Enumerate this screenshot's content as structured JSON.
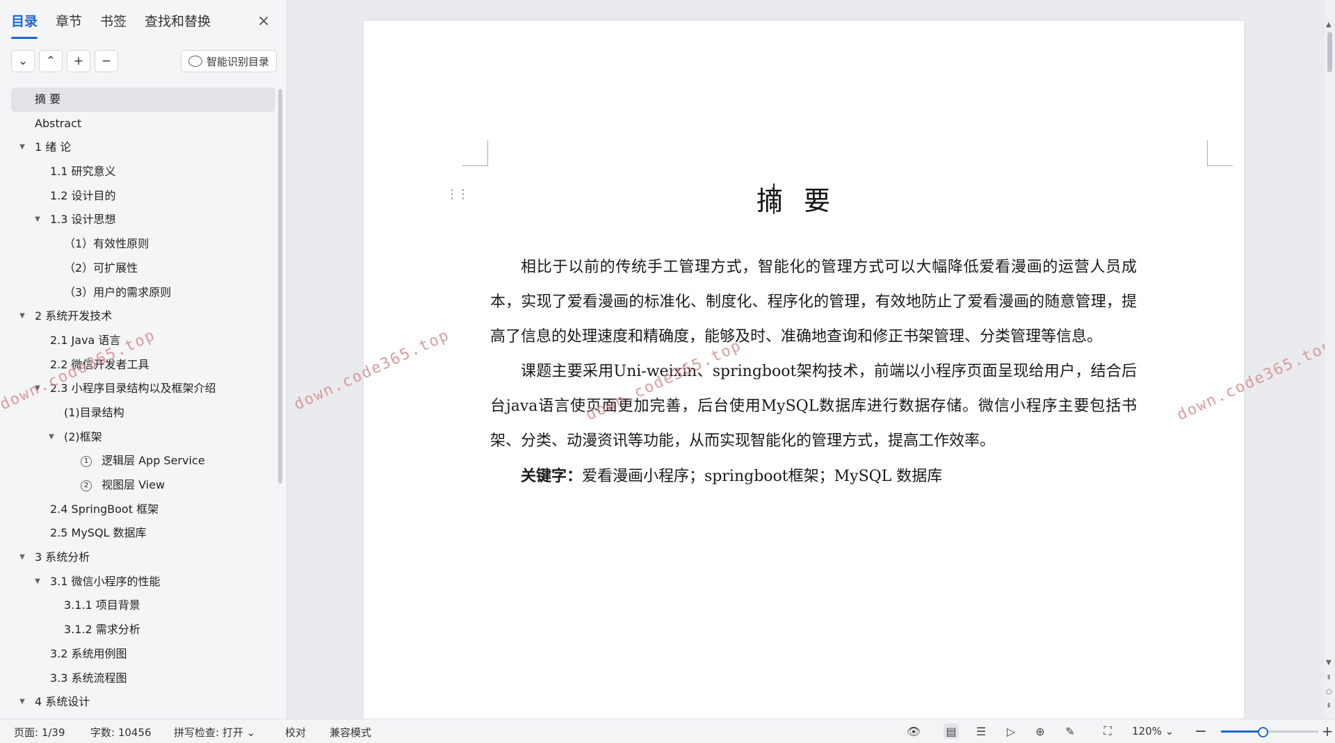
{
  "sidebar": {
    "tabs": [
      "目录",
      "章节",
      "书签",
      "查找和替换"
    ],
    "active_tab": "目录",
    "close_icon": "×",
    "tools": [
      "⌄",
      "⌃",
      "+",
      "−"
    ],
    "ai_button_label": "智能识别目录",
    "toc": [
      {
        "label": "摘  要",
        "level": 1,
        "selected": true,
        "toggle": false
      },
      {
        "label": "Abstract",
        "level": 1,
        "toggle": false
      },
      {
        "label": "1  绪  论",
        "level": 1,
        "toggle": true
      },
      {
        "label": "1.1 研究意义",
        "level": 2,
        "toggle": false
      },
      {
        "label": "1.2 设计目的",
        "level": 2,
        "toggle": false
      },
      {
        "label": "1.3 设计思想",
        "level": 2,
        "toggle": true
      },
      {
        "label": "（1）有效性原则",
        "level": 3,
        "toggle": false
      },
      {
        "label": "（2）可扩展性",
        "level": 3,
        "toggle": false
      },
      {
        "label": "（3）用户的需求原则",
        "level": 3,
        "toggle": false
      },
      {
        "label": "2 系统开发技术",
        "level": 1,
        "toggle": true
      },
      {
        "label": "2.1 Java 语言",
        "level": 2,
        "toggle": false
      },
      {
        "label": "2.2 微信开发者工具",
        "level": 2,
        "toggle": false
      },
      {
        "label": "2.3 小程序目录结构以及框架介绍",
        "level": 2,
        "toggle": true
      },
      {
        "label": "(1)目录结构",
        "level": 3,
        "toggle": false
      },
      {
        "label": "(2)框架",
        "level": 3,
        "toggle": true
      },
      {
        "label": "逻辑层 App Service",
        "level": 4,
        "marker": "1",
        "toggle": false
      },
      {
        "label": "视图层 View",
        "level": 4,
        "marker": "2",
        "toggle": false
      },
      {
        "label": "2.4 SpringBoot 框架",
        "level": 2,
        "toggle": false
      },
      {
        "label": "2.5 MySQL 数据库",
        "level": 2,
        "toggle": false
      },
      {
        "label": "3 系统分析",
        "level": 1,
        "toggle": true
      },
      {
        "label": "3.1 微信小程序的性能",
        "level": 2,
        "toggle": true
      },
      {
        "label": "3.1.1 项目背景",
        "level": 3,
        "toggle": false
      },
      {
        "label": "3.1.2 需求分析",
        "level": 3,
        "toggle": false
      },
      {
        "label": "3.2 系统用例图",
        "level": 2,
        "toggle": false
      },
      {
        "label": "3.3  系统流程图",
        "level": 2,
        "toggle": false
      },
      {
        "label": "4  系统设计",
        "level": 1,
        "toggle": true
      }
    ]
  },
  "document": {
    "title": "摘要",
    "paragraphs": [
      "相比于以前的传统手工管理方式，智能化的管理方式可以大幅降低爱看漫画的运营人员成本，实现了爱看漫画的标准化、制度化、程序化的管理，有效地防止了爱看漫画的随意管理，提高了信息的处理速度和精确度，能够及时、准确地查询和修正书架管理、分类管理等信息。",
      "课题主要采用Uni-weixin、springboot架构技术，前端以小程序页面呈现给用户，结合后台java语言使页面更加完善，后台使用MySQL数据库进行数据存储。微信小程序主要包括书架、分类、动漫资讯等功能，从而实现智能化的管理方式，提高工作效率。"
    ],
    "keywords_label": "关键字：",
    "keywords": "爱看漫画小程序；springboot框架；MySQL 数据库",
    "watermark": "down.code365.top"
  },
  "status": {
    "page": "页面: 1/39",
    "words": "字数: 10456",
    "spellcheck": "拼写检查: 打开",
    "proof": "校对",
    "compat": "兼容模式",
    "zoom": "120%",
    "zoom_level": 0.43
  }
}
